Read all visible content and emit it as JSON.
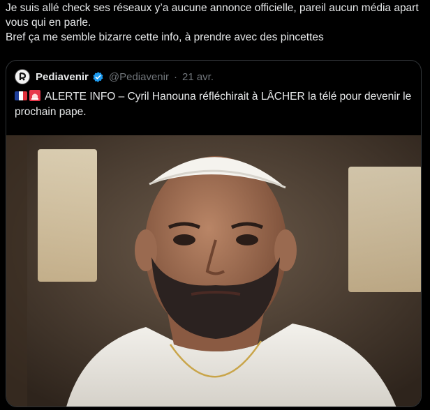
{
  "post": {
    "text": "Je suis allé check ses réseaux y’a aucune annonce officielle, pareil aucun média apart vous qui en parle.\nBref ça me semble bizarre cette info, à prendre avec des pincettes"
  },
  "quoted_post": {
    "author_name": "Pediavenir",
    "handle": "@Pediavenir",
    "separator": "·",
    "date": "21 avr.",
    "verified": true,
    "text": "ALERTE INFO – Cyril Hanouna réfléchirait à LÂCHER la télé pour devenir le prochain pape.",
    "emoji": [
      "flag-france-icon",
      "police-siren-icon"
    ]
  },
  "colors": {
    "background": "#000000",
    "text": "#e7e9ea",
    "muted": "#71767b",
    "border": "#2f3336",
    "verified_badge": "#1d9bf0"
  }
}
